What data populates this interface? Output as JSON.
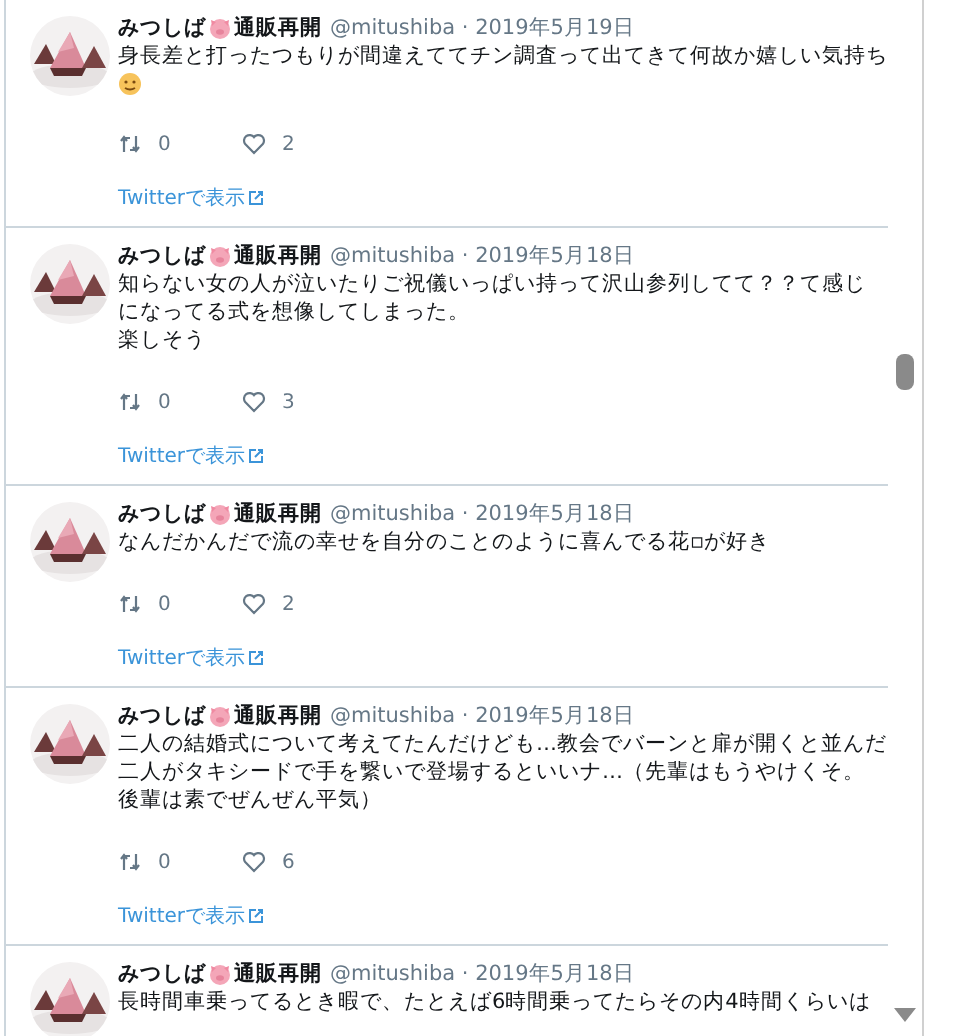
{
  "tweets": [
    {
      "name": "みつしば",
      "name_suffix": "通販再開",
      "meta": "@mitushiba · 2019年5月19日",
      "lines": [
        "身長差と打ったつもりが間違えててチン調査って出てきて何故か嬉しい気持ち"
      ],
      "trailing_emoji": true,
      "retweets": "0",
      "likes": "2",
      "link": "Twitterで表示"
    },
    {
      "name": "みつしば",
      "name_suffix": "通販再開",
      "meta": "@mitushiba · 2019年5月18日",
      "lines": [
        "知らない女の人が泣いたりご祝儀いっぱい持って沢山参列してて？？て感じ",
        "になってる式を想像してしまった。",
        "楽しそう"
      ],
      "trailing_emoji": false,
      "retweets": "0",
      "likes": "3",
      "link": "Twitterで表示"
    },
    {
      "name": "みつしば",
      "name_suffix": "通販再開",
      "meta": "@mitushiba · 2019年5月18日",
      "lines": [
        "なんだかんだで流の幸せを自分のことのように喜んでる花▫が好き"
      ],
      "trailing_emoji": false,
      "retweets": "0",
      "likes": "2",
      "link": "Twitterで表示"
    },
    {
      "name": "みつしば",
      "name_suffix": "通販再開",
      "meta": "@mitushiba · 2019年5月18日",
      "lines": [
        "二人の結婚式について考えてたんだけども…教会でバーンと扉が開くと並んだ",
        "二人がタキシードで手を繋いで登場するといいナ…（先輩はもうやけくそ。",
        "後輩は素でぜんぜん平気）"
      ],
      "trailing_emoji": false,
      "retweets": "0",
      "likes": "6",
      "link": "Twitterで表示"
    },
    {
      "name": "みつしば",
      "name_suffix": "通販再開",
      "meta": "@mitushiba · 2019年5月18日",
      "lines": [
        "長時間車乗ってるとき暇で、たとえば6時間乗ってたらその内4時間くらいは"
      ],
      "trailing_emoji": false
    }
  ]
}
